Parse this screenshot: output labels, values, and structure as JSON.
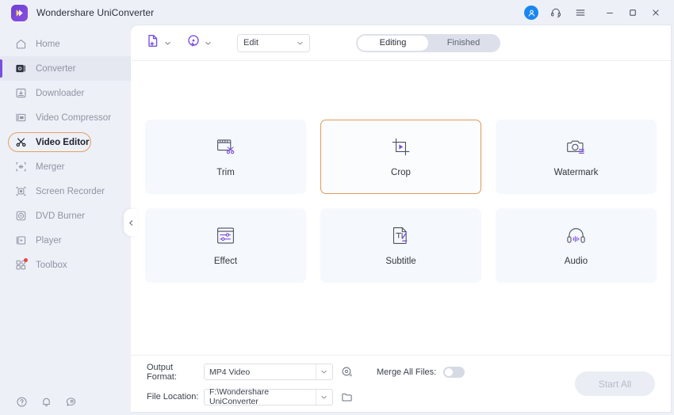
{
  "titlebar": {
    "app_title": "Wondershare UniConverter",
    "logo_icon": "wondershare-logo-icon",
    "account_icon": "user-avatar-icon",
    "support_icon": "headset-icon",
    "menu_icon": "hamburger-menu-icon",
    "minimize_icon": "minimize-icon",
    "maximize_icon": "maximize-icon",
    "close_icon": "close-icon"
  },
  "sidebar": {
    "collapse_icon": "chevron-left-icon",
    "items": [
      {
        "label": "Home",
        "icon": "home-icon",
        "active": false,
        "badge": false
      },
      {
        "label": "Converter",
        "icon": "converter-icon",
        "active": false,
        "badge": false
      },
      {
        "label": "Downloader",
        "icon": "downloader-icon",
        "active": false,
        "badge": false
      },
      {
        "label": "Video Compressor",
        "icon": "compressor-icon",
        "active": false,
        "badge": false
      },
      {
        "label": "Video Editor",
        "icon": "scissors-icon",
        "active": true,
        "badge": false
      },
      {
        "label": "Merger",
        "icon": "merger-icon",
        "active": false,
        "badge": false
      },
      {
        "label": "Screen Recorder",
        "icon": "screen-recorder-icon",
        "active": false,
        "badge": false
      },
      {
        "label": "DVD Burner",
        "icon": "dvd-burner-icon",
        "active": false,
        "badge": false
      },
      {
        "label": "Player",
        "icon": "player-icon",
        "active": false,
        "badge": false
      },
      {
        "label": "Toolbox",
        "icon": "toolbox-icon",
        "active": false,
        "badge": true
      }
    ],
    "bottom_icons": [
      {
        "name": "help-icon"
      },
      {
        "name": "notification-bell-icon"
      },
      {
        "name": "feedback-icon"
      }
    ]
  },
  "toolbar": {
    "add_files_icon": "add-file-icon",
    "add_files_caret_icon": "chevron-down-icon",
    "add_disc_icon": "add-disc-icon",
    "add_disc_caret_icon": "chevron-down-icon",
    "mode_select_value": "Edit",
    "mode_select_caret_icon": "chevron-down-icon",
    "segments": [
      {
        "label": "Editing",
        "active": true
      },
      {
        "label": "Finished",
        "active": false
      }
    ]
  },
  "cards": [
    {
      "label": "Trim",
      "icon": "trim-icon",
      "selected": false
    },
    {
      "label": "Crop",
      "icon": "crop-icon",
      "selected": true
    },
    {
      "label": "Watermark",
      "icon": "watermark-icon",
      "selected": false
    },
    {
      "label": "Effect",
      "icon": "effect-icon",
      "selected": false
    },
    {
      "label": "Subtitle",
      "icon": "subtitle-icon",
      "selected": false
    },
    {
      "label": "Audio",
      "icon": "audio-icon",
      "selected": false
    }
  ],
  "bottom": {
    "output_format_label": "Output Format:",
    "output_format_value": "MP4 Video",
    "output_format_caret_icon": "chevron-down-icon",
    "output_settings_icon": "settings-gear-icon",
    "file_location_label": "File Location:",
    "file_location_value": "F:\\Wondershare UniConverter",
    "file_location_caret_icon": "chevron-down-icon",
    "folder_icon": "folder-icon",
    "merge_label": "Merge All Files:",
    "merge_enabled": false,
    "start_all_label": "Start All",
    "start_all_enabled": false
  },
  "colors": {
    "accent_purple": "#7b4fe0",
    "selection_orange": "#e09a58",
    "sidebar_bg": "#eef0f7",
    "card_bg": "#f5f8fc",
    "avatar_blue": "#1a86f0",
    "badge_red": "#ef4444"
  }
}
